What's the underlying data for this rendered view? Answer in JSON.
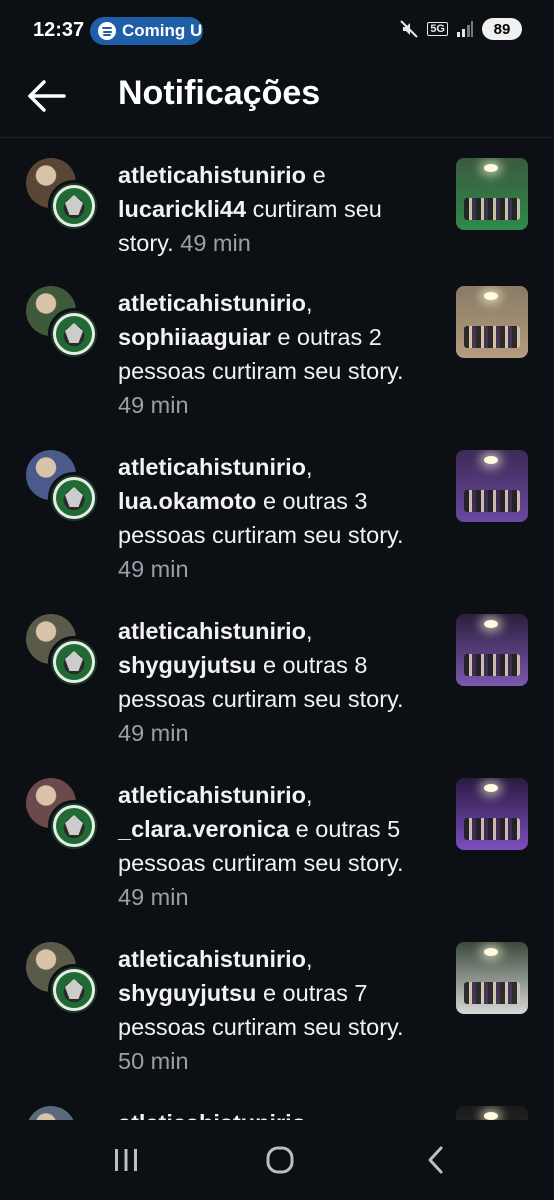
{
  "status_bar": {
    "time": "12:37",
    "media_label": "Coming U",
    "network": "5G",
    "battery": "89"
  },
  "header": {
    "title": "Notificações"
  },
  "notifications": [
    {
      "users": "atleticahistunirio",
      "connector": " e ",
      "user2": "lucarickli44",
      "rest": " curtiram seu story.",
      "time": "49 min",
      "avatar_color": "#5a4634",
      "thumb_bg": "#3b5a3f",
      "thumb_accent": "#2f8a4a"
    },
    {
      "users": "atleticahistunirio",
      "connector": ", ",
      "user2": "sophiiaaguiar",
      "rest": " e outras 2 pessoas curtiram seu story.",
      "time": "49 min",
      "avatar_color": "#3f5a3a",
      "thumb_bg": "#8a7a64",
      "thumb_accent": "#b59d7e"
    },
    {
      "users": "atleticahistunirio",
      "connector": ", ",
      "user2": "lua.okamoto",
      "rest": " e outras 3 pessoas curtiram seu story.",
      "time": "49 min",
      "avatar_color": "#4a5a8a",
      "thumb_bg": "#3d2a55",
      "thumb_accent": "#6a4aa0"
    },
    {
      "users": "atleticahistunirio",
      "connector": ", ",
      "user2": "shyguyjutsu",
      "rest": " e outras 8 pessoas curtiram seu story.",
      "time": "49 min",
      "avatar_color": "#5a5a4a",
      "thumb_bg": "#2a1f3d",
      "thumb_accent": "#7a5ab0"
    },
    {
      "users": "atleticahistunirio",
      "connector": ", ",
      "user2": "_clara.veronica",
      "rest": " e outras 5 pessoas curtiram seu story.",
      "time": "49 min",
      "avatar_color": "#6a4a4a",
      "thumb_bg": "#2a1a40",
      "thumb_accent": "#7c4fc0"
    },
    {
      "users": "atleticahistunirio",
      "connector": ", ",
      "user2": "shyguyjutsu",
      "rest": " e outras 7 pessoas curtiram seu story.",
      "time": "50 min",
      "avatar_color": "#5a5a4a",
      "thumb_bg": "#3a4a3a",
      "thumb_accent": "#d8d8d8"
    },
    {
      "users": "atleticahistunirio",
      "connector": "",
      "user2": "",
      "rest": "",
      "time": "",
      "avatar_color": "#5a6a7a",
      "thumb_bg": "#1a1a1a",
      "thumb_accent": "#333333"
    }
  ],
  "nav": {
    "recents": "recents-icon",
    "home": "home-icon",
    "back": "back-icon"
  }
}
